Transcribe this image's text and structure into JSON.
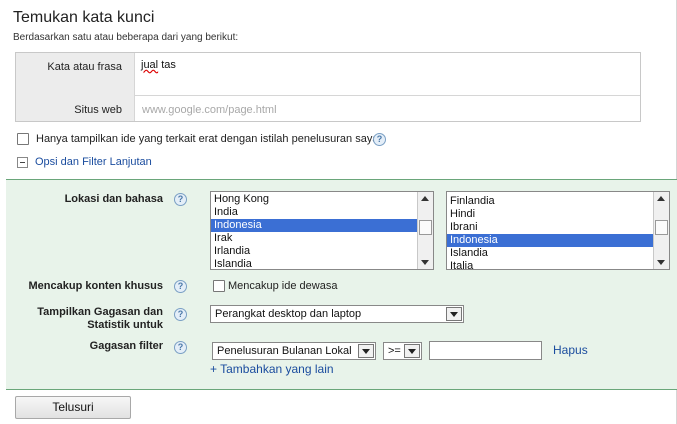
{
  "header": {
    "title": "Temukan kata kunci",
    "subtitle": "Berdasarkan satu atau beberapa dari yang berikut:"
  },
  "inputs": {
    "keyword_label": "Kata atau frasa",
    "keyword_value_word1": "jual",
    "keyword_value_word2": "tas",
    "website_label": "Situs web",
    "website_placeholder": "www.google.com/page.html"
  },
  "options": {
    "closely_related_label": "Hanya tampilkan ide yang terkait erat dengan istilah penelusuran saya",
    "advanced_link": "Opsi dan Filter Lanjutan"
  },
  "advanced": {
    "location_label": "Lokasi dan bahasa",
    "locations": [
      "Hong Kong",
      "India",
      "Indonesia",
      "Irak",
      "Irlandia",
      "Islandia"
    ],
    "locations_selected_index": 2,
    "languages": [
      "Finlandia",
      "Hindi",
      "Ibrani",
      "Indonesia",
      "Islandia",
      "Italia"
    ],
    "languages_selected_index": 3,
    "special_content_label": "Mencakup konten khusus",
    "adult_ideas_label": "Mencakup ide dewasa",
    "show_ideas_label_line1": "Tampilkan Gagasan dan",
    "show_ideas_label_line2": "Statistik untuk",
    "device_value": "Perangkat desktop dan laptop",
    "idea_filter_label": "Gagasan filter",
    "filter_metric_value": "Penelusuran Bulanan Lokal",
    "filter_operator_value": ">=",
    "filter_amount_value": "",
    "remove_link": "Hapus",
    "add_more_link": "+ Tambahkan yang lain"
  },
  "actions": {
    "search_button": "Telusuri"
  },
  "icons": {
    "help": "help-icon",
    "collapse": "collapse-minus-icon"
  },
  "colors": {
    "panel_bg": "#e8f3ea",
    "panel_border": "#6aa67a",
    "link": "#1a4c9e",
    "selection": "#3b6fd4"
  }
}
